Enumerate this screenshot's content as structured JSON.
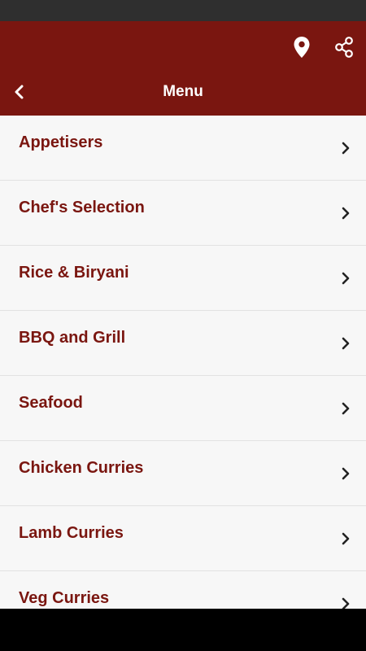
{
  "app_bar": {
    "title": "Menu",
    "icons": {
      "back": "chevron-left-icon",
      "location": "map-pin-icon",
      "share": "share-icon"
    },
    "background_color": "#7a1610"
  },
  "menu": {
    "items": [
      {
        "label": "Appetisers"
      },
      {
        "label": "Chef's Selection"
      },
      {
        "label": "Rice & Biryani"
      },
      {
        "label": "BBQ and Grill"
      },
      {
        "label": "Seafood"
      },
      {
        "label": "Chicken Curries"
      },
      {
        "label": "Lamb Curries"
      },
      {
        "label": "Veg Curries"
      }
    ],
    "item_icon": "chevron-right-icon",
    "label_color": "#7a1610"
  }
}
